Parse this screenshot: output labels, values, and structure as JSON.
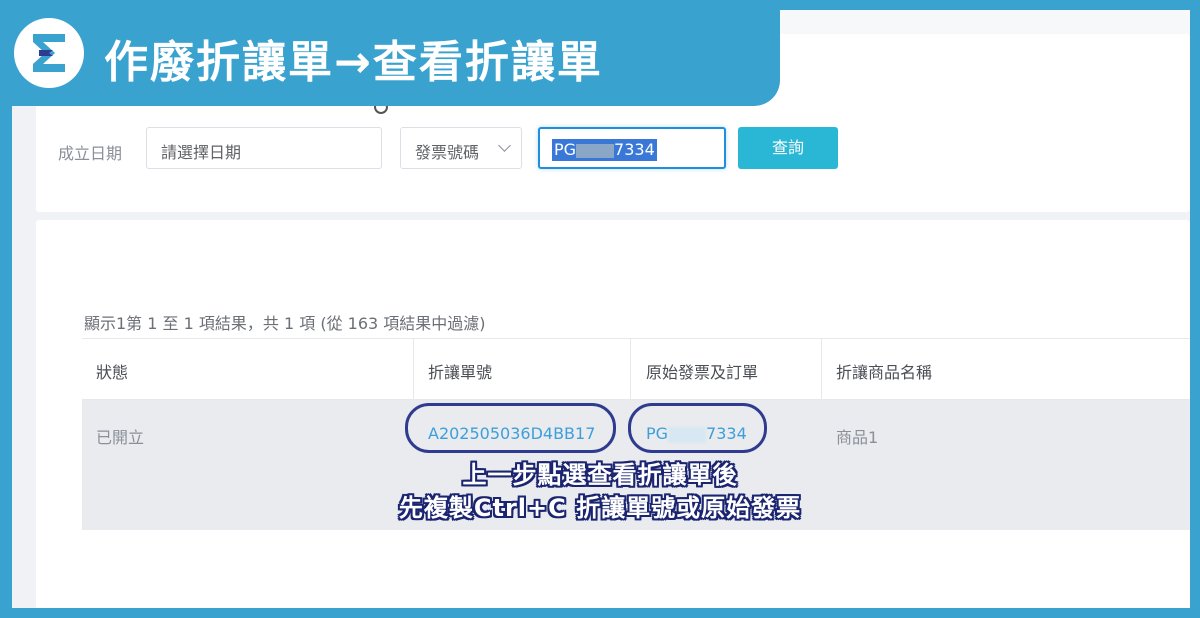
{
  "banner": {
    "title": "作廢折讓單→查看折讓單",
    "logo_icon": "brand-e-logo-icon"
  },
  "filters": {
    "date_label": "成立日期",
    "date_placeholder": "請選擇日期",
    "field_select": "發票號碼",
    "search_prefix": "PG",
    "search_suffix": "7334",
    "query_button": "查詢"
  },
  "results": {
    "info": "顯示1第 1 至 1 項結果，共 1 項 (從 163 項結果中過濾)"
  },
  "table": {
    "headers": [
      "狀態",
      "折讓單號",
      "原始發票及訂單",
      "折讓商品名稱"
    ],
    "rows": [
      {
        "status": "已開立",
        "allowance_no": "A202505036D4BB17",
        "invoice_prefix": "PG",
        "invoice_suffix": "7334",
        "product": "商品1"
      }
    ]
  },
  "caption": {
    "line1": "上一步點選查看折讓單後",
    "line2": "先複製Ctrl+C 折讓單號或原始發票"
  },
  "colors": {
    "frame": "#3aa2cf",
    "accent_button": "#29b7d5",
    "link": "#3c9fdc",
    "highlight_circle": "#2f3b8e"
  }
}
